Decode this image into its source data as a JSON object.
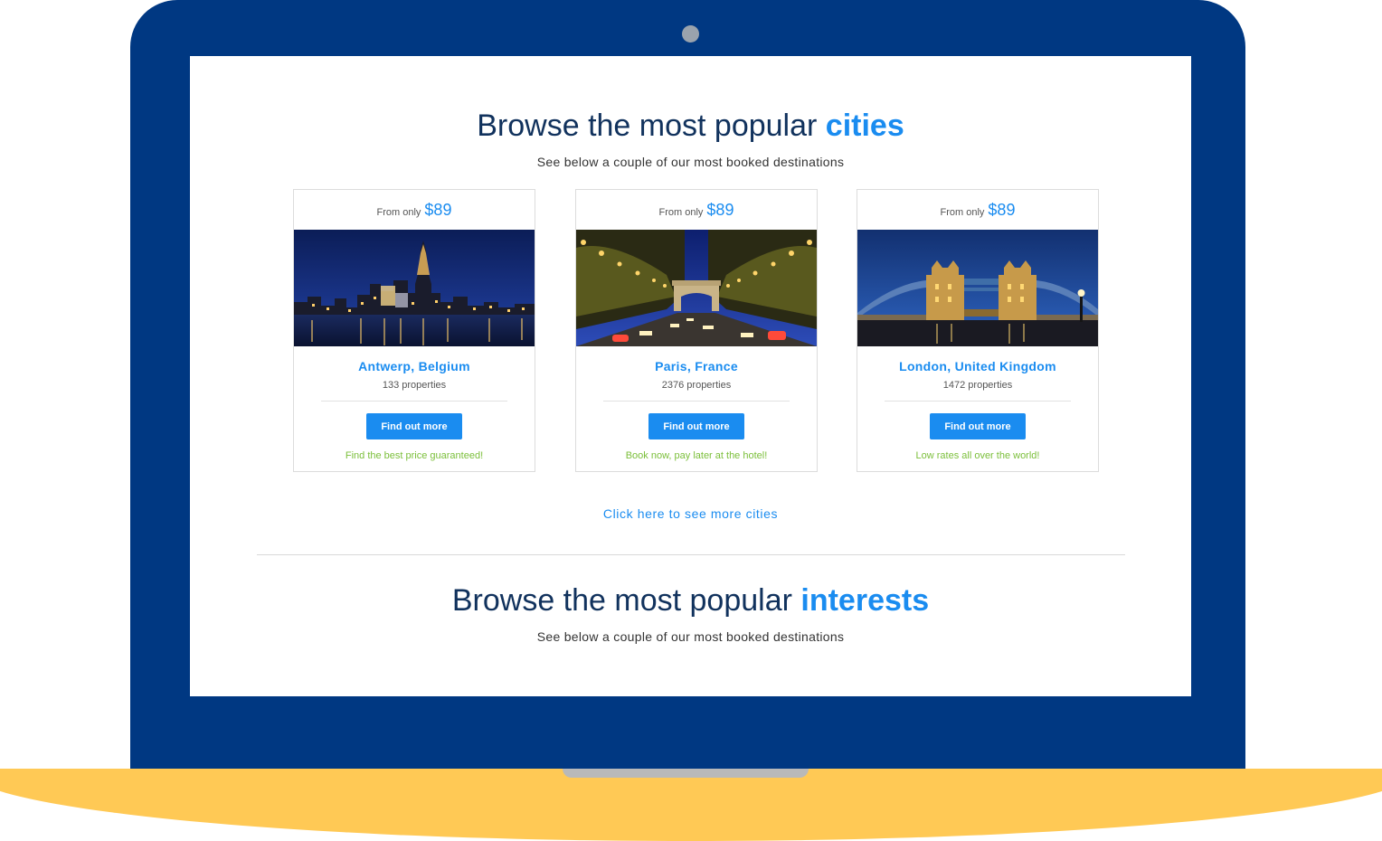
{
  "colors": {
    "frame": "#003882",
    "base": "#ffc955",
    "accent": "#1a8cf0",
    "heading": "#11325d",
    "tagline": "#7bbf3a"
  },
  "cities_section": {
    "title_plain": "Browse the most popular",
    "title_accent": "cities",
    "subtitle": "See below a couple of our most booked destinations",
    "more_link": "Click here to see more cities"
  },
  "cards": [
    {
      "price_label": "From only",
      "price": "$89",
      "image_icon": "antwerp-night-skyline",
      "city": "Antwerp, Belgium",
      "properties": "133 properties",
      "button": "Find out more",
      "tagline": "Find the best price guaranteed!"
    },
    {
      "price_label": "From only",
      "price": "$89",
      "image_icon": "paris-arc-de-triomphe-night",
      "city": "Paris, France",
      "properties": "2376 properties",
      "button": "Find out more",
      "tagline": "Book now, pay later at the hotel!"
    },
    {
      "price_label": "From only",
      "price": "$89",
      "image_icon": "london-tower-bridge-night",
      "city": "London, United Kingdom",
      "properties": "1472 properties",
      "button": "Find out more",
      "tagline": "Low rates all over the world!"
    }
  ],
  "interests_section": {
    "title_plain": "Browse the most popular",
    "title_accent": "interests",
    "subtitle": "See below a couple of our most booked destinations"
  }
}
